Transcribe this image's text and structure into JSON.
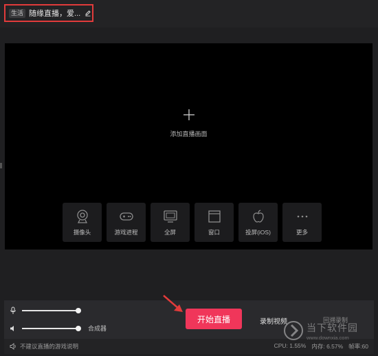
{
  "header": {
    "category_tag": "生活",
    "title": "随缘直播，爱...",
    "edit_icon": "pencil-icon"
  },
  "preview": {
    "add_label": "添加直播画面",
    "sources": [
      {
        "label": "摄像头",
        "icon": "webcam-icon"
      },
      {
        "label": "游戏进程",
        "icon": "gamepad-icon"
      },
      {
        "label": "全屏",
        "icon": "monitor-icon"
      },
      {
        "label": "窗口",
        "icon": "window-icon"
      },
      {
        "label": "投屏(iOS)",
        "icon": "apple-icon"
      },
      {
        "label": "更多",
        "icon": "more-icon"
      }
    ]
  },
  "controls": {
    "mic_level": 1.0,
    "speaker_level": 1.0,
    "mixer_label": "合成器",
    "start_button": "开始直播",
    "record_button": "录制视频",
    "replay_button": "回溯录制"
  },
  "status": {
    "warning": "不建议直播的游戏说明",
    "cpu": "CPU: 1.55%",
    "memory": "内存: 6.57%",
    "fps": "帧率:60"
  },
  "watermark": {
    "line1": "当下软件园",
    "line2": "www.downxia.com"
  },
  "colors": {
    "accent": "#f0365a",
    "highlight_border": "#e23b3b",
    "annotation_arrow": "#e23b3b"
  }
}
